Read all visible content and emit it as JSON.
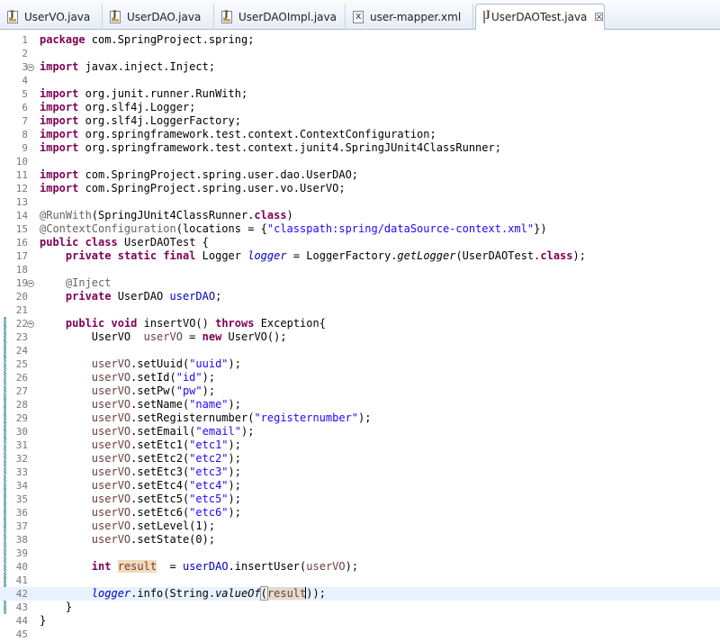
{
  "tabs": [
    {
      "label": "UserVO.java",
      "type": "java",
      "active": false
    },
    {
      "label": "UserDAO.java",
      "type": "java",
      "active": false
    },
    {
      "label": "UserDAOImpl.java",
      "type": "java",
      "active": false
    },
    {
      "label": "user-mapper.xml",
      "type": "xml",
      "active": false
    },
    {
      "label": "UserDAOTest.java",
      "type": "java",
      "active": true
    }
  ],
  "close_glyph": "☒",
  "editor": {
    "colors": {
      "keyword": "#7f0055",
      "string": "#2a00ff",
      "annotation": "#646464",
      "field": "#0000c0",
      "local": "#6a3e3e",
      "occurrence_highlight": "#f3d9ba",
      "current_line": "#e8f2fe"
    },
    "current_line": 42,
    "folded_lines": [
      3,
      19,
      22
    ],
    "changed_lines_from": 22,
    "changed_lines_to": 43,
    "lines": [
      {
        "n": "1",
        "text": "package com.SpringProject.spring;"
      },
      {
        "n": "2",
        "text": ""
      },
      {
        "n": "3",
        "text": "import javax.inject.Inject;"
      },
      {
        "n": "4",
        "text": ""
      },
      {
        "n": "5",
        "text": "import org.junit.runner.RunWith;"
      },
      {
        "n": "6",
        "text": "import org.slf4j.Logger;"
      },
      {
        "n": "7",
        "text": "import org.slf4j.LoggerFactory;"
      },
      {
        "n": "8",
        "text": "import org.springframework.test.context.ContextConfiguration;"
      },
      {
        "n": "9",
        "text": "import org.springframework.test.context.junit4.SpringJUnit4ClassRunner;"
      },
      {
        "n": "10",
        "text": ""
      },
      {
        "n": "11",
        "text": "import com.SpringProject.spring.user.dao.UserDAO;"
      },
      {
        "n": "12",
        "text": "import com.SpringProject.spring.user.vo.UserVO;"
      },
      {
        "n": "13",
        "text": ""
      },
      {
        "n": "14",
        "text": "@RunWith(SpringJUnit4ClassRunner.class)"
      },
      {
        "n": "15",
        "text": "@ContextConfiguration(locations = {\"classpath:spring/dataSource-context.xml\"})"
      },
      {
        "n": "16",
        "text": "public class UserDAOTest {"
      },
      {
        "n": "17",
        "text": "    private static final Logger logger = LoggerFactory.getLogger(UserDAOTest.class);"
      },
      {
        "n": "18",
        "text": ""
      },
      {
        "n": "19",
        "text": "    @Inject"
      },
      {
        "n": "20",
        "text": "    private UserDAO userDAO;"
      },
      {
        "n": "21",
        "text": ""
      },
      {
        "n": "22",
        "text": "    public void insertVO() throws Exception{"
      },
      {
        "n": "23",
        "text": "        UserVO  userVO = new UserVO();"
      },
      {
        "n": "24",
        "text": ""
      },
      {
        "n": "25",
        "text": "        userVO.setUuid(\"uuid\");"
      },
      {
        "n": "26",
        "text": "        userVO.setId(\"id\");"
      },
      {
        "n": "27",
        "text": "        userVO.setPw(\"pw\");"
      },
      {
        "n": "28",
        "text": "        userVO.setName(\"name\");"
      },
      {
        "n": "29",
        "text": "        userVO.setRegisternumber(\"registernumber\");"
      },
      {
        "n": "30",
        "text": "        userVO.setEmail(\"email\");"
      },
      {
        "n": "31",
        "text": "        userVO.setEtc1(\"etc1\");"
      },
      {
        "n": "32",
        "text": "        userVO.setEtc2(\"etc2\");"
      },
      {
        "n": "33",
        "text": "        userVO.setEtc3(\"etc3\");"
      },
      {
        "n": "34",
        "text": "        userVO.setEtc4(\"etc4\");"
      },
      {
        "n": "35",
        "text": "        userVO.setEtc5(\"etc5\");"
      },
      {
        "n": "36",
        "text": "        userVO.setEtc6(\"etc6\");"
      },
      {
        "n": "37",
        "text": "        userVO.setLevel(1);"
      },
      {
        "n": "38",
        "text": "        userVO.setState(0);"
      },
      {
        "n": "39",
        "text": ""
      },
      {
        "n": "40",
        "text": "        int result  = userDAO.insertUser(userVO);"
      },
      {
        "n": "41",
        "text": ""
      },
      {
        "n": "42",
        "text": "        logger.info(String.valueOf(result));"
      },
      {
        "n": "43",
        "text": "    }"
      },
      {
        "n": "44",
        "text": "}"
      },
      {
        "n": "45",
        "text": ""
      }
    ]
  }
}
